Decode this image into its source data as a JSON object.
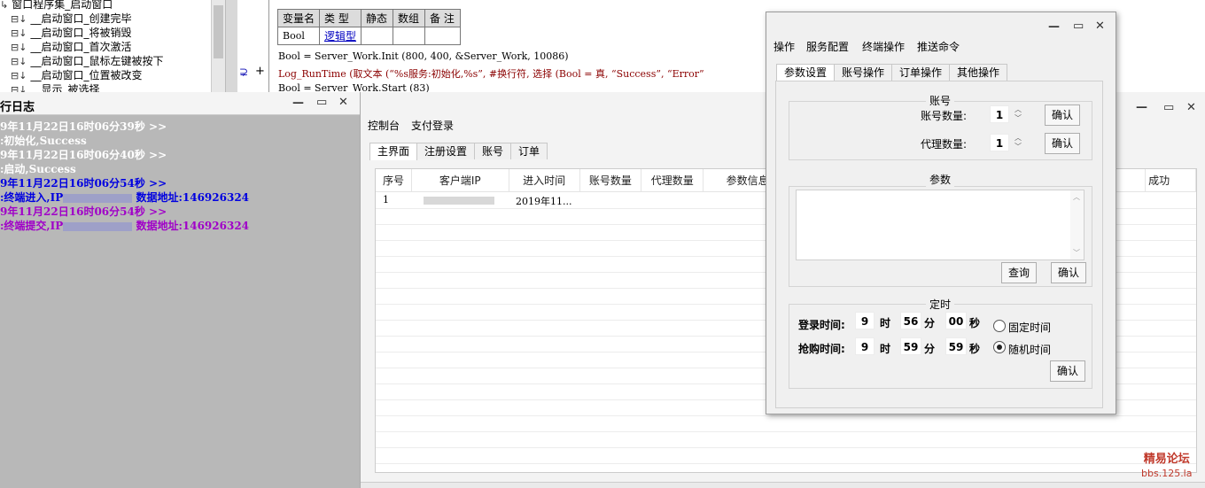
{
  "tree": {
    "items": [
      {
        "icon": "↳",
        "label": "窗口程序集_启动窗口"
      },
      {
        "icon": "⊟↓",
        "label": "__启动窗口_创建完毕"
      },
      {
        "icon": "⊟↓",
        "label": "__启动窗口_将被销毁"
      },
      {
        "icon": "⊟↓",
        "label": "__启动窗口_首次激活"
      },
      {
        "icon": "⊟↓",
        "label": "__启动窗口_鼠标左键被按下"
      },
      {
        "icon": "⊟↓",
        "label": "__启动窗口_位置被改变"
      },
      {
        "icon": "⊟↓",
        "label": "__显示_被选择"
      }
    ]
  },
  "code": {
    "var_table": {
      "headers": [
        "变量名",
        "类 型",
        "静态",
        "数组",
        "备 注"
      ],
      "row": [
        "Bool",
        "逻辑型",
        "",
        "",
        ""
      ]
    },
    "lines": [
      "Bool = Server_Work.Init (800, 400, &Server_Work, 10086)",
      "Log_RunTime (取文本 (“%s服务:初始化,%s”, #换行符, 选择 (Bool = 真, “Success”, “Error”",
      "Bool = Server_Work.Start (83)"
    ],
    "gutter_mark": "⊋",
    "gutter_plus": "+"
  },
  "log_window": {
    "title": "行日志",
    "lines": [
      {
        "text": "9年11月22日16时06分39秒 >>",
        "color": "white"
      },
      {
        "text": ":初始化,Success",
        "color": "white"
      },
      {
        "text": "9年11月22日16时06分40秒 >>",
        "color": "white"
      },
      {
        "text": ":启动,Success",
        "color": "white"
      },
      {
        "text": "9年11月22日16时06分54秒 >>",
        "color": "blue"
      },
      {
        "text_pre": ":终端进入,IP",
        "text_post": "数据地址:146926324",
        "color": "blue"
      },
      {
        "text": "9年11月22日16时06分54秒 >>",
        "color": "purple"
      },
      {
        "text_pre": ":终端提交,IP",
        "text_post": "数据地址:146926324",
        "color": "purple"
      }
    ]
  },
  "server_window": {
    "menu": [
      "控制台",
      "支付登录"
    ],
    "tabs": [
      "主界面",
      "注册设置",
      "账号",
      "订单"
    ],
    "columns": [
      "序号",
      "客户端IP",
      "进入时间",
      "账号数量",
      "代理数量",
      "参数信息",
      "",
      "",
      "",
      "",
      "",
      "成功"
    ],
    "rows": [
      {
        "index": "1",
        "time": "2019年11..."
      }
    ]
  },
  "config_window": {
    "menu": [
      "操作",
      "服务配置",
      "终端操作",
      "推送命令"
    ],
    "tabs": [
      "参数设置",
      "账号操作",
      "订单操作",
      "其他操作"
    ],
    "account_group": {
      "title": "账号",
      "account_count_label": "账号数量:",
      "account_count": "1",
      "proxy_count_label": "代理数量:",
      "proxy_count": "1",
      "confirm": "确认"
    },
    "param_group": {
      "title": "参数",
      "query": "查询",
      "confirm": "确认"
    },
    "timer_group": {
      "title": "定时",
      "login_label": "登录时间:",
      "login_h": "9",
      "login_m": "56",
      "login_s": "00",
      "grab_label": "抢购时间:",
      "grab_h": "9",
      "grab_m": "59",
      "grab_s": "59",
      "unit_h": "时",
      "unit_m": "分",
      "unit_s": "秒",
      "fixed": "固定时间",
      "random": "随机时间",
      "selected": "random",
      "confirm": "确认"
    }
  },
  "watermark": {
    "line1": "精易论坛",
    "line2": "bbs.125.la"
  }
}
